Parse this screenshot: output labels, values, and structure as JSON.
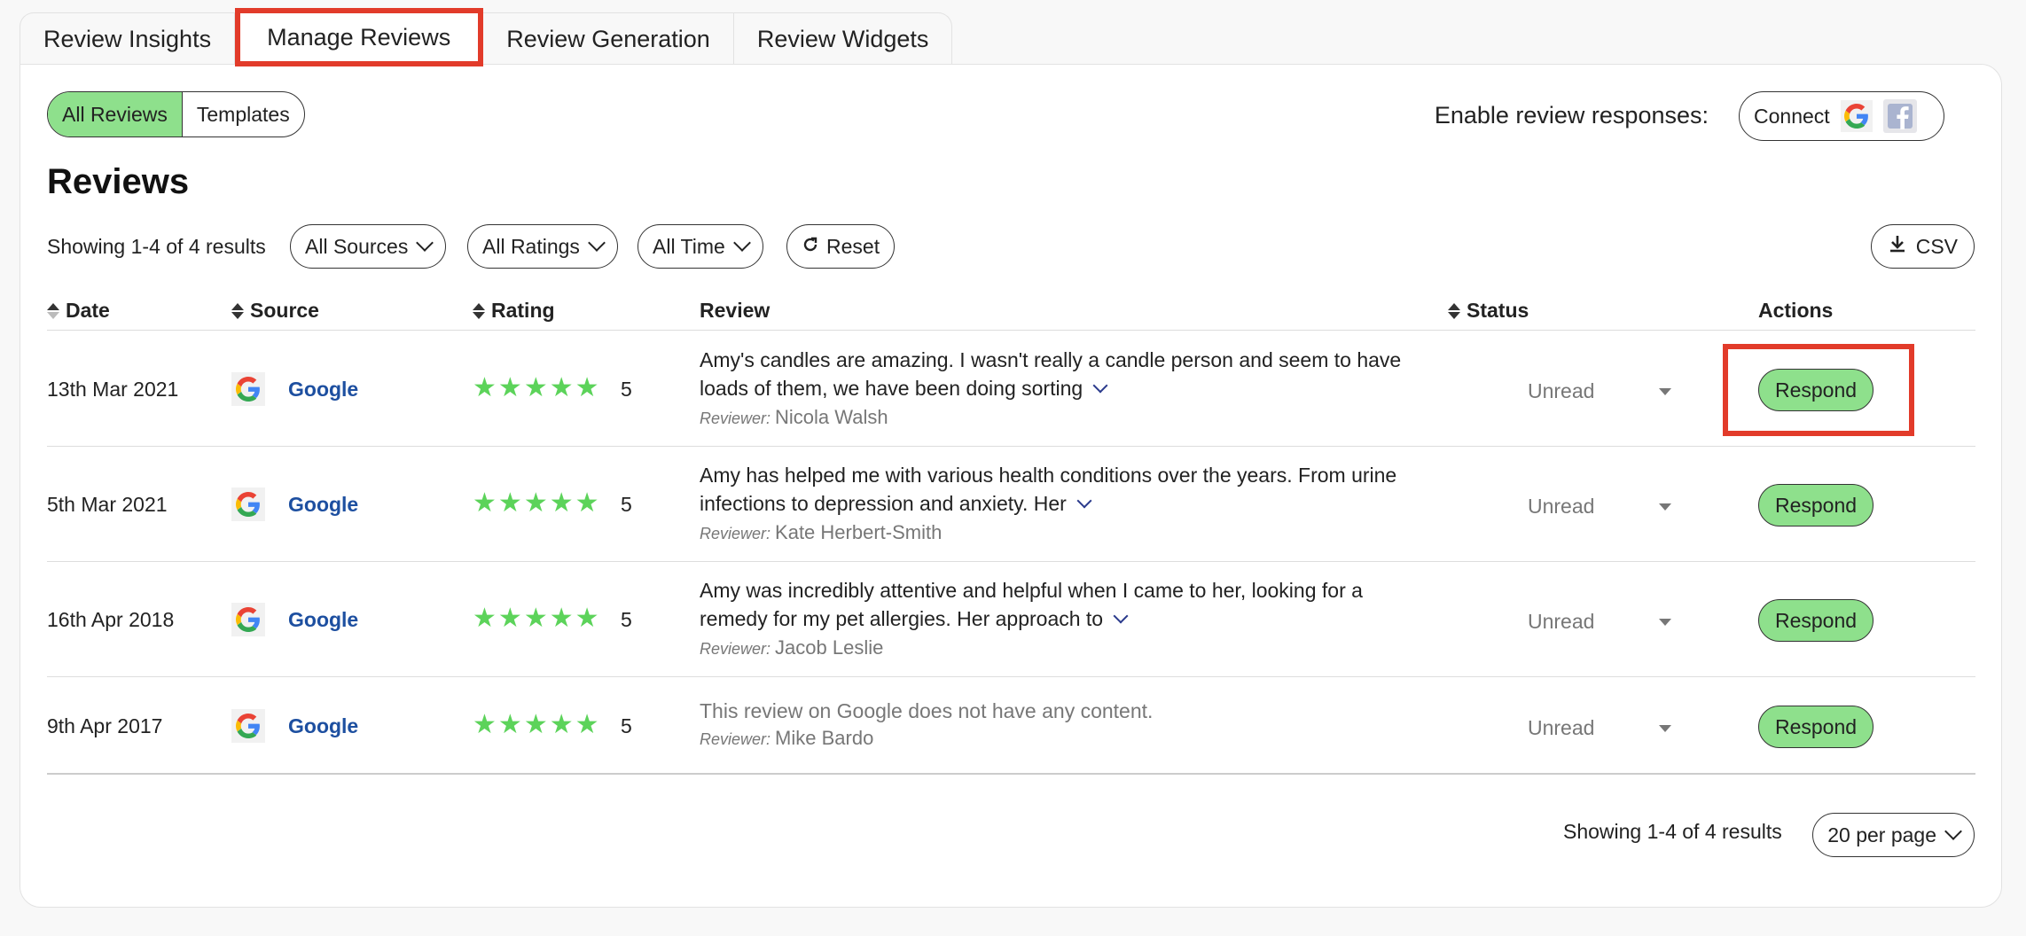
{
  "tabs": [
    {
      "label": "Review Insights"
    },
    {
      "label": "Manage Reviews"
    },
    {
      "label": "Review Generation"
    },
    {
      "label": "Review Widgets"
    }
  ],
  "view_toggle": {
    "all_reviews": "All Reviews",
    "templates": "Templates"
  },
  "enable_responses": {
    "label": "Enable review responses:",
    "connect": "Connect",
    "icons": [
      "google-icon",
      "facebook-icon"
    ]
  },
  "page_title": "Reviews",
  "filters": {
    "showing": "Showing 1-4 of 4 results",
    "sources": "All Sources",
    "ratings": "All Ratings",
    "time": "All Time",
    "reset": "Reset",
    "csv": "CSV"
  },
  "table": {
    "headers": {
      "date": "Date",
      "source": "Source",
      "rating": "Rating",
      "review": "Review",
      "status": "Status",
      "actions": "Actions"
    },
    "reviewer_label": "Reviewer:",
    "rows": [
      {
        "date": "13th Mar 2021",
        "source": "Google",
        "stars": 5,
        "rating": "5",
        "review": "Amy's candles are amazing. I wasn't really a candle person and seem to have loads of them, we have been doing sorting",
        "reviewer": "Nicola Walsh",
        "status": "Unread",
        "action": "Respond"
      },
      {
        "date": "5th Mar 2021",
        "source": "Google",
        "stars": 5,
        "rating": "5",
        "review": "Amy has helped me with various health conditions over the years. From urine infections to depression and anxiety. Her",
        "reviewer": "Kate Herbert-Smith",
        "status": "Unread",
        "action": "Respond"
      },
      {
        "date": "16th Apr 2018",
        "source": "Google",
        "stars": 5,
        "rating": "5",
        "review": "Amy was incredibly attentive and helpful when I came to her, looking for a remedy for my pet allergies. Her approach to",
        "reviewer": "Jacob Leslie",
        "status": "Unread",
        "action": "Respond"
      },
      {
        "date": "9th Apr 2017",
        "source": "Google",
        "stars": 5,
        "rating": "5",
        "review": "This review on Google does not have any content.",
        "reviewer": "Mike Bardo",
        "status": "Unread",
        "action": "Respond"
      }
    ]
  },
  "pagination": {
    "showing": "Showing 1-4 of 4 results",
    "per_page": "20 per page"
  },
  "colors": {
    "accent_green": "#8ee08c",
    "star_green": "#5cd35a",
    "link_blue": "#1d4fa0",
    "highlight_red": "#e23b2a"
  }
}
